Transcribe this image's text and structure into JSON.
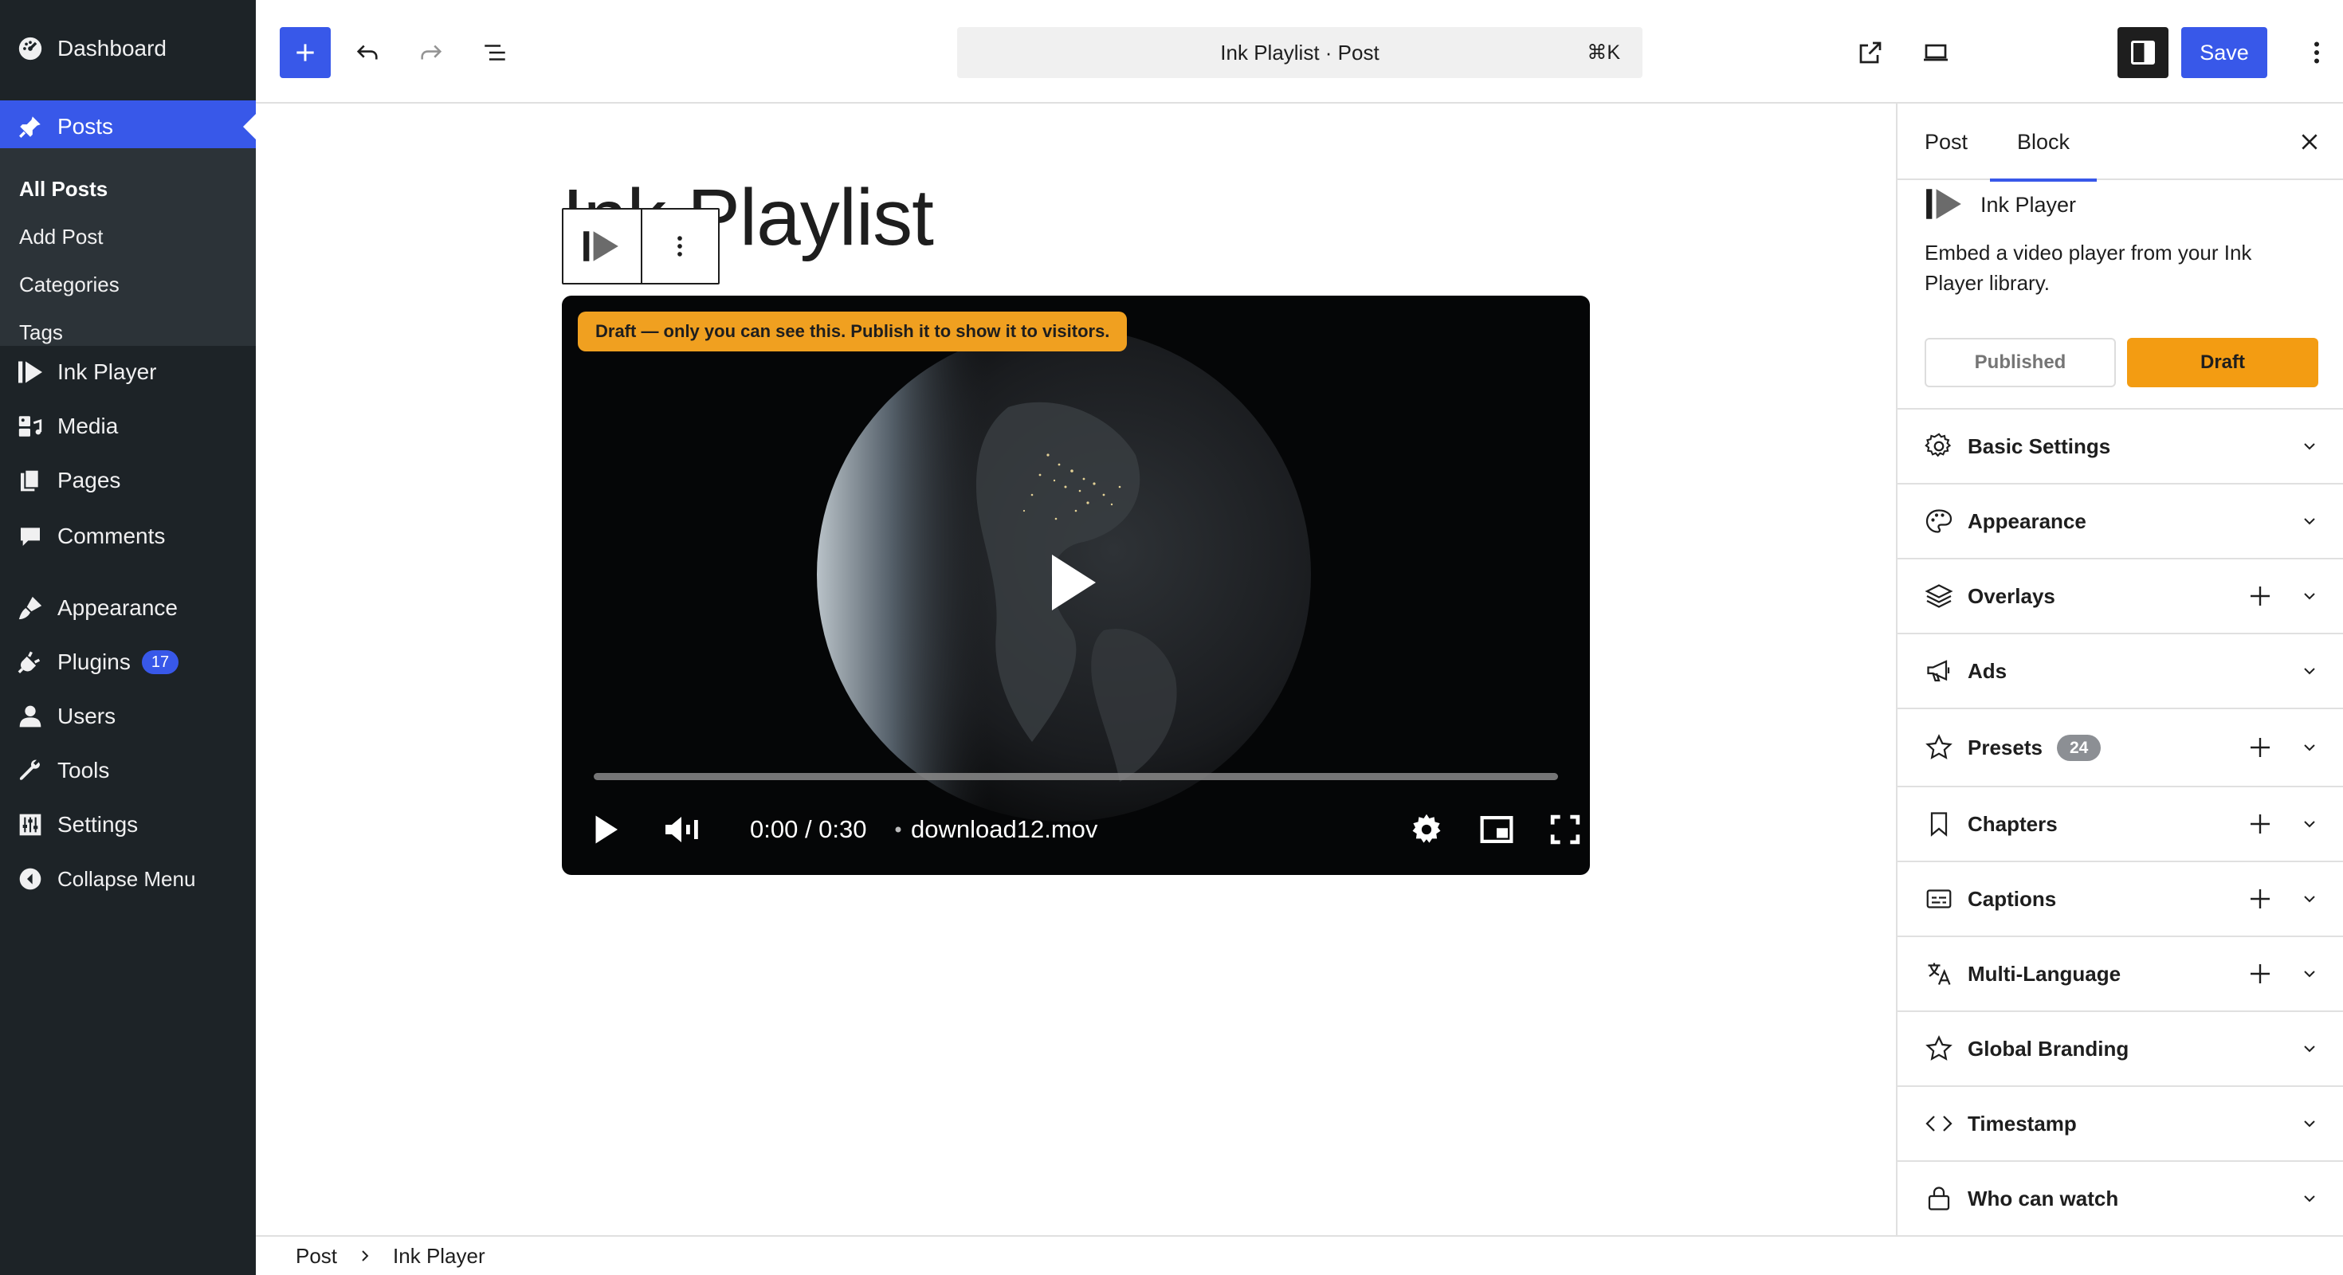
{
  "admin_menu": {
    "dashboard": "Dashboard",
    "posts": "Posts",
    "posts_submenu": [
      "All Posts",
      "Add Post",
      "Categories",
      "Tags"
    ],
    "ink_player": "Ink Player",
    "media": "Media",
    "pages": "Pages",
    "comments": "Comments",
    "appearance": "Appearance",
    "plugins": "Plugins",
    "plugins_badge": "17",
    "users": "Users",
    "tools": "Tools",
    "settings": "Settings",
    "collapse": "Collapse Menu"
  },
  "toolbar": {
    "command_title": "Ink Playlist · Post",
    "command_shortcut": "⌘K",
    "save_label": "Save"
  },
  "editor": {
    "post_title": "Ink Playlist",
    "draft_notice": "Draft — only you can see this. Publish it to show it to visitors.",
    "player_time": "0:00 / 0:30",
    "player_file": "download12.mov",
    "progress_fraction": 0.0
  },
  "sidebar": {
    "tabs": [
      "Post",
      "Block"
    ],
    "active_tab": "Block",
    "block_name": "Ink Player",
    "block_description": "Embed a video player from your Ink Player library.",
    "status_options": [
      "Published",
      "Draft"
    ],
    "active_status": "Draft",
    "panels": [
      {
        "title": "Basic Settings",
        "icon": "gear-icon",
        "add": false
      },
      {
        "title": "Appearance",
        "icon": "palette-icon",
        "add": false
      },
      {
        "title": "Overlays",
        "icon": "layers-icon",
        "add": true
      },
      {
        "title": "Ads",
        "icon": "megaphone-icon",
        "add": false
      },
      {
        "title": "Presets",
        "icon": "star-icon",
        "add": true,
        "count": "24"
      },
      {
        "title": "Chapters",
        "icon": "bookmark-icon",
        "add": true
      },
      {
        "title": "Captions",
        "icon": "captions-icon",
        "add": true
      },
      {
        "title": "Multi-Language",
        "icon": "translate-icon",
        "add": true
      },
      {
        "title": "Global Branding",
        "icon": "star-icon",
        "add": false
      },
      {
        "title": "Timestamp",
        "icon": "code-icon",
        "add": false
      },
      {
        "title": "Who can watch",
        "icon": "lock-icon",
        "add": false
      }
    ]
  },
  "breadcrumb": [
    "Post",
    "Ink Player"
  ],
  "colors": {
    "admin_bg": "#1d2327",
    "accent": "#3858e9",
    "draft_orange": "#f39c12"
  }
}
